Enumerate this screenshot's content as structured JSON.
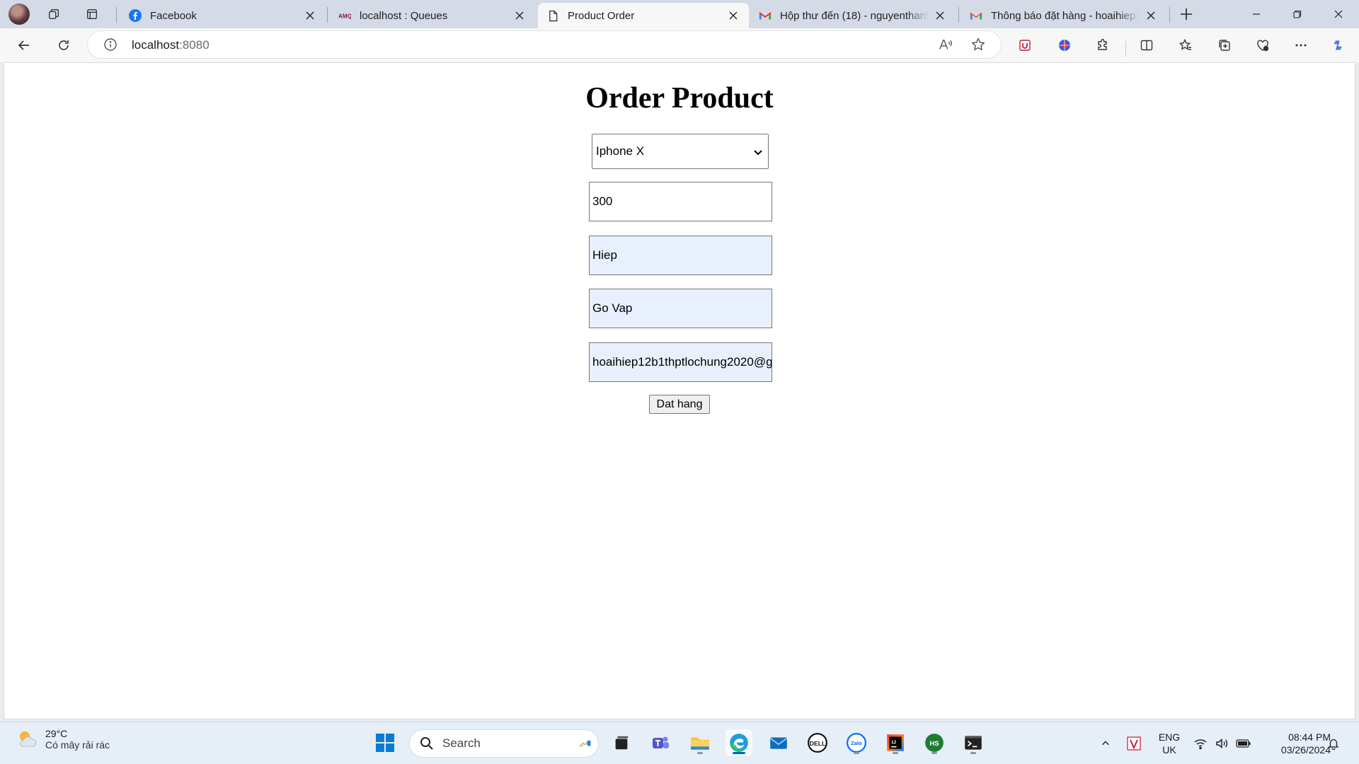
{
  "browser": {
    "tabs": [
      {
        "title": "Facebook",
        "icon": "facebook-icon"
      },
      {
        "title": "localhost : Queues",
        "icon": "amq-icon"
      },
      {
        "title": "Product Order",
        "icon": "page-icon"
      },
      {
        "title": "Hộp thư đến (18) - nguyenthanh",
        "icon": "gmail-icon"
      },
      {
        "title": "Thông báo đặt hàng - hoaihiep1",
        "icon": "gmail-icon"
      }
    ],
    "amq_label": "AMQ",
    "address": {
      "host": "localhost",
      "port": ":8080"
    }
  },
  "page": {
    "heading": "Order Product",
    "product_select": {
      "selected": "Iphone X"
    },
    "fields": {
      "quantity": "300",
      "name": "Hiep",
      "address": "Go Vap",
      "email": "hoaihiep12b1thptlochung2020@g"
    },
    "submit_label": "Dat hang"
  },
  "taskbar": {
    "weather": {
      "temp": "29°C",
      "condition": "Có mây rải rác"
    },
    "search_placeholder": "Search",
    "dell_label": "DELL",
    "zalo_label": "Zalo",
    "ij_label": "IJ",
    "hs_label": "HS",
    "language": {
      "line1": "ENG",
      "line2": "UK"
    },
    "clock": {
      "time": "08:44 PM",
      "date": "03/26/2024"
    }
  },
  "colors": {
    "accent": "#0067c0",
    "autofill_bg": "#e8f0fe",
    "tabstrip_bg": "#d4dbe6"
  }
}
